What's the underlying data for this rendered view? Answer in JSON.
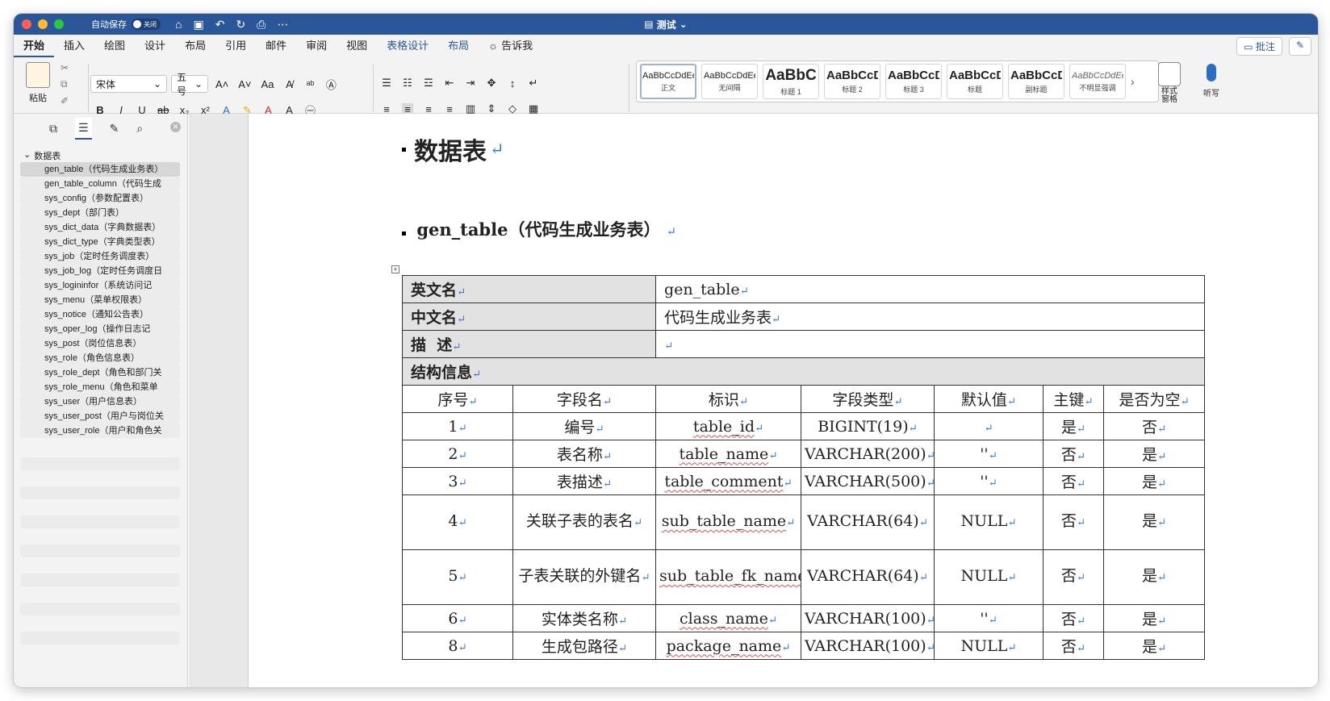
{
  "window": {
    "autosave_label": "自动保存",
    "autosave_state": "关闭",
    "doc_title": "测试"
  },
  "tabs": [
    "开始",
    "插入",
    "绘图",
    "设计",
    "布局",
    "引用",
    "邮件",
    "审阅",
    "视图",
    "表格设计",
    "布局"
  ],
  "tell_me": "告诉我",
  "comment_button": "批注",
  "ribbon": {
    "paste_label": "粘贴",
    "font_name": "宋体",
    "font_size": "五号",
    "styles": [
      {
        "preview": "AaBbCcDdEe",
        "name": "正文",
        "kind": "normal"
      },
      {
        "preview": "AaBbCcDdEe",
        "name": "无间隔",
        "kind": "normal"
      },
      {
        "preview": "AaBbC",
        "name": "标题 1",
        "kind": "big"
      },
      {
        "preview": "AaBbCcD",
        "name": "标题 2",
        "kind": "mid"
      },
      {
        "preview": "AaBbCcD",
        "name": "标题 3",
        "kind": "mid"
      },
      {
        "preview": "AaBbCcD",
        "name": "标题",
        "kind": "mid"
      },
      {
        "preview": "AaBbCcD",
        "name": "副标题",
        "kind": "mid"
      },
      {
        "preview": "AaBbCcDdEe",
        "name": "不明显强调",
        "kind": "it"
      }
    ],
    "styles_pane_label": "样式\n窗格",
    "dictate_label": "听写"
  },
  "nav": {
    "root": "数据表",
    "items": [
      "gen_table（代码生成业务表）",
      "gen_table_column（代码生成",
      "sys_config（参数配置表）",
      "sys_dept（部门表）",
      "sys_dict_data（字典数据表）",
      "sys_dict_type（字典类型表）",
      "sys_job（定时任务调度表）",
      "sys_job_log（定时任务调度日",
      "sys_logininfor（系统访问记",
      "sys_menu（菜单权限表）",
      "sys_notice（通知公告表）",
      "sys_oper_log（操作日志记",
      "sys_post（岗位信息表）",
      "sys_role（角色信息表）",
      "sys_role_dept（角色和部门关",
      "sys_role_menu（角色和菜单",
      "sys_user（用户信息表）",
      "sys_user_post（用户与岗位关",
      "sys_user_role（用户和角色关"
    ]
  },
  "document": {
    "h1": "数据表",
    "h2": "gen_table（代码生成业务表）",
    "return_mark": "↵",
    "meta": {
      "en_label": "英文名",
      "en_value": "gen_table",
      "cn_label": "中文名",
      "cn_value": "代码生成业务表",
      "desc_label": "描  述",
      "desc_value": "",
      "struct_label": "结构信息"
    },
    "columns": [
      "序号",
      "字段名",
      "标识",
      "字段类型",
      "默认值",
      "主键",
      "是否为空"
    ],
    "rows": [
      {
        "no": "1",
        "name": "编号",
        "id": "table_id",
        "type": "BIGINT(19)",
        "def": "",
        "pk": "是",
        "null": "否"
      },
      {
        "no": "2",
        "name": "表名称",
        "id": "table_name",
        "type": "VARCHAR(200)",
        "def": "''",
        "pk": "否",
        "null": "是"
      },
      {
        "no": "3",
        "name": "表描述",
        "id": "table_comment",
        "type": "VARCHAR(500)",
        "def": "''",
        "pk": "否",
        "null": "是"
      },
      {
        "no": "4",
        "name": "关联子表的表名",
        "id": "sub_table_name",
        "type": "VARCHAR(64)",
        "def": "NULL",
        "pk": "否",
        "null": "是"
      },
      {
        "no": "5",
        "name": "子表关联的外键名",
        "id": "sub_table_fk_name",
        "type": "VARCHAR(64)",
        "def": "NULL",
        "pk": "否",
        "null": "是"
      },
      {
        "no": "6",
        "name": "实体类名称",
        "id": "class_name",
        "type": "VARCHAR(100)",
        "def": "''",
        "pk": "否",
        "null": "是"
      },
      {
        "no": "8",
        "name": "生成包路径",
        "id": "package_name",
        "type": "VARCHAR(100)",
        "def": "NULL",
        "pk": "否",
        "null": "是"
      }
    ]
  }
}
